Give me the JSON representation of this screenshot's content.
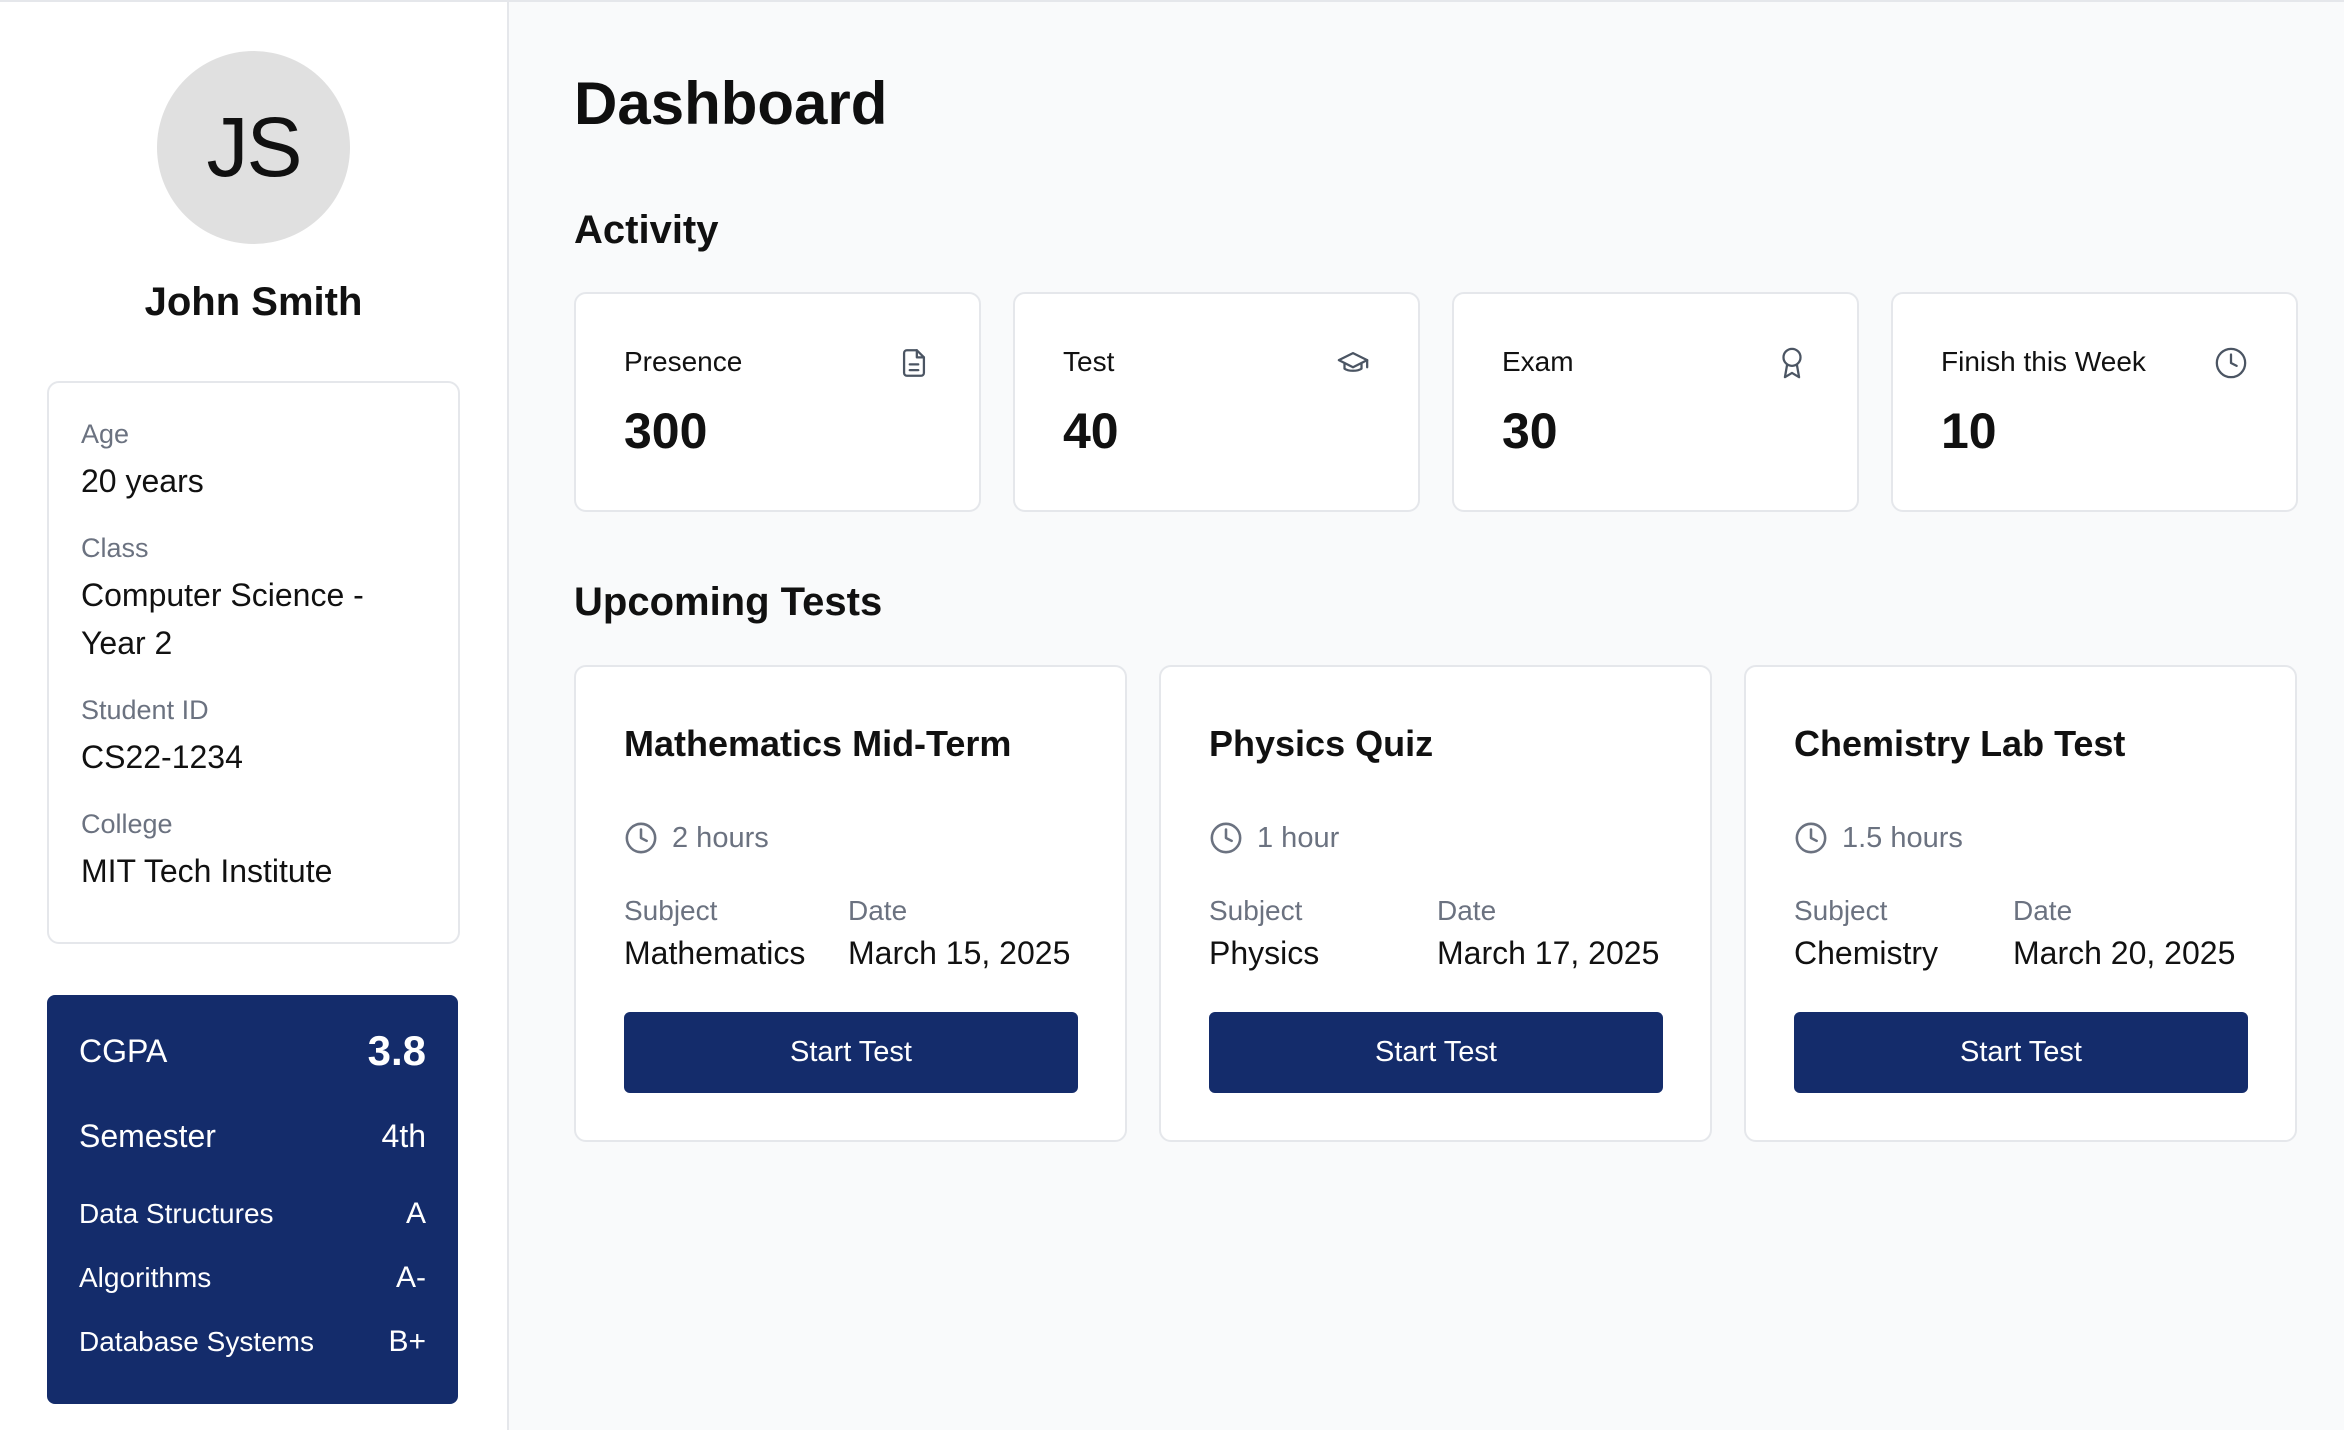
{
  "profile": {
    "initials": "JS",
    "name": "John Smith",
    "details": [
      {
        "label": "Age",
        "value": "20 years"
      },
      {
        "label": "Class",
        "value": "Computer Science - Year 2"
      },
      {
        "label": "Student ID",
        "value": "CS22-1234"
      },
      {
        "label": "College",
        "value": "MIT Tech Institute"
      }
    ]
  },
  "grades": {
    "cgpa_label": "CGPA",
    "cgpa_value": "3.8",
    "semester_label": "Semester",
    "semester_value": "4th",
    "courses": [
      {
        "name": "Data Structures",
        "grade": "A"
      },
      {
        "name": "Algorithms",
        "grade": "A-"
      },
      {
        "name": "Database Systems",
        "grade": "B+"
      }
    ]
  },
  "page": {
    "title": "Dashboard",
    "activity_title": "Activity",
    "upcoming_title": "Upcoming Tests"
  },
  "activity": [
    {
      "label": "Presence",
      "value": "300",
      "icon": "document-icon"
    },
    {
      "label": "Test",
      "value": "40",
      "icon": "graduation-cap-icon"
    },
    {
      "label": "Exam",
      "value": "30",
      "icon": "award-icon"
    },
    {
      "label": "Finish this Week",
      "value": "10",
      "icon": "clock-icon"
    }
  ],
  "tests": [
    {
      "title": "Mathematics Mid-Term",
      "duration": "2 hours",
      "subject_label": "Subject",
      "subject": "Mathematics",
      "date_label": "Date",
      "date": "March 15, 2025",
      "button": "Start Test"
    },
    {
      "title": "Physics Quiz",
      "duration": "1 hour",
      "subject_label": "Subject",
      "subject": "Physics",
      "date_label": "Date",
      "date": "March 17, 2025",
      "button": "Start Test"
    },
    {
      "title": "Chemistry Lab Test",
      "duration": "1.5 hours",
      "subject_label": "Subject",
      "subject": "Chemistry",
      "date_label": "Date",
      "date": "March 20, 2025",
      "button": "Start Test"
    }
  ],
  "colors": {
    "primary": "#142c6b",
    "muted_text": "#6b7280",
    "border": "#e5e7eb",
    "avatar_bg": "#e0e0e0"
  }
}
